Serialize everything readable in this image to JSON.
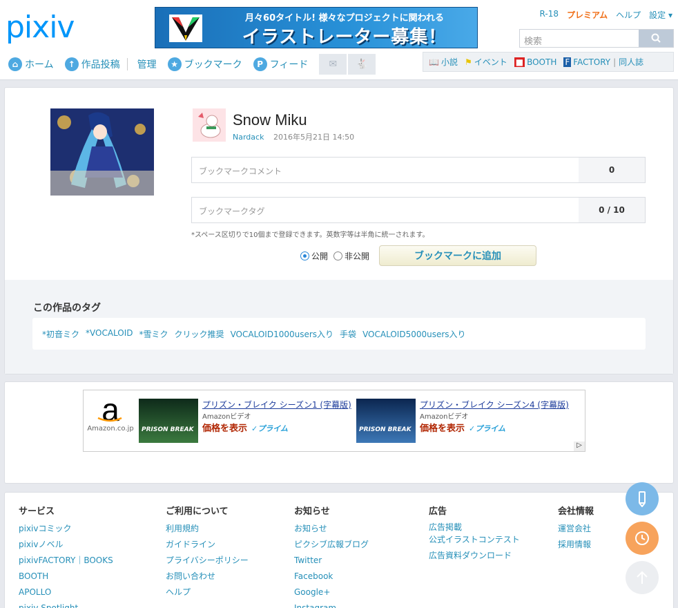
{
  "header": {
    "logo": "pixiv",
    "banner_line1": "月々60タイトル! 様々なプロジェクトに関われる",
    "banner_line2": "イラストレーター募集！",
    "toplinks": [
      "R-18",
      "プレミアム",
      "ヘルプ",
      "設定 ▾"
    ],
    "search_placeholder": "検索",
    "nav": [
      "ホーム",
      "作品投稿",
      "管理",
      "ブックマーク",
      "フィード"
    ],
    "rightnav": [
      "小説",
      "イベント",
      "BOOTH",
      "FACTORY",
      "同人誌"
    ]
  },
  "work": {
    "title": "Snow Miku",
    "author": "Nardack",
    "date": "2016年5月21日 14:50",
    "comment_placeholder": "ブックマークコメント",
    "comment_count": "0",
    "tag_placeholder": "ブックマークタグ",
    "tag_count": "0 / 10",
    "note": "*スペース区切りで10個まで登録できます。英数字等は半角に統一されます。",
    "public_label": "公開",
    "private_label": "非公開",
    "add_button": "ブックマークに追加",
    "tags_heading": "この作品のタグ",
    "tags": [
      "*初音ミク",
      "*VOCALOID",
      "*雪ミク",
      "クリック推奨",
      "VOCALOID1000users入り",
      "手袋",
      "VOCALOID5000users入り"
    ]
  },
  "ad": {
    "brand": "a",
    "brand_sub": "Amazon.co.jp",
    "products": [
      {
        "title": "プリズン・ブレイク シーズン1 (字幕版)",
        "sub": "Amazonビデオ",
        "price": "価格を表示",
        "prime": "✓プライム",
        "poster": "PRISON BREAK"
      },
      {
        "title": "プリズン・ブレイク シーズン4 (字幕版)",
        "sub": "Amazonビデオ",
        "price": "価格を表示",
        "prime": "✓プライム",
        "poster": "PRISON BREAK"
      }
    ]
  },
  "footer": {
    "columns": [
      {
        "heading": "サービス",
        "links": [
          "pixivコミック",
          "pixivノベル",
          "pixivFACTORY｜BOOKS",
          "BOOTH",
          "APOLLO",
          "pixiv Spotlight"
        ]
      },
      {
        "heading": "ご利用について",
        "links": [
          "利用規約",
          "ガイドライン",
          "プライバシーポリシー",
          "お問い合わせ",
          "ヘルプ"
        ]
      },
      {
        "heading": "お知らせ",
        "links": [
          "お知らせ",
          "ピクシブ広報ブログ",
          "Twitter",
          "Facebook",
          "Google+",
          "Instagram"
        ]
      },
      {
        "heading": "広告",
        "links": [
          "広告掲載",
          "公式イラストコンテスト",
          "広告資料ダウンロード"
        ]
      },
      {
        "heading": "会社情報",
        "links": [
          "運営会社",
          "採用情報"
        ]
      }
    ]
  }
}
